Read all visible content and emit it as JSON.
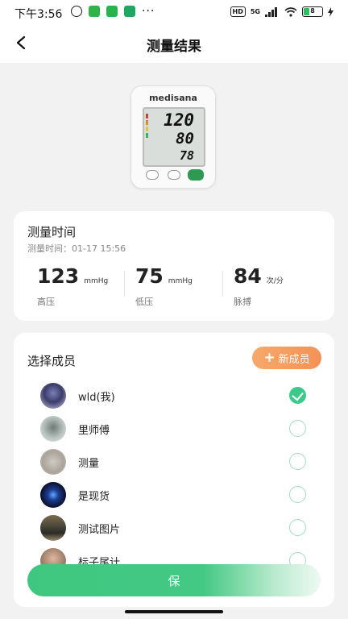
{
  "status_bar": {
    "time": "下午3:56",
    "left_icons": [
      "alarm-icon",
      "green-app-icon",
      "wechat-icon",
      "shield-app-icon",
      "more-dots-icon"
    ],
    "right": {
      "hd": "HD",
      "network": "5G",
      "battery": "8"
    }
  },
  "nav": {
    "title": "测量结果",
    "back_icon": "chevron-left-icon"
  },
  "device": {
    "brand": "medisana",
    "display": [
      "120",
      "80",
      "78"
    ]
  },
  "measurement": {
    "title": "测量时间",
    "time_label": "测量时间：01-17 15:56",
    "metrics": [
      {
        "value": "123",
        "unit": "mmHg",
        "label": "高压"
      },
      {
        "value": "75",
        "unit": "mmHg",
        "label": "低压"
      },
      {
        "value": "84",
        "unit": "次/分",
        "label": "脉搏"
      }
    ]
  },
  "members": {
    "title": "选择成员",
    "new_button": "新成员",
    "items": [
      {
        "name": "wld(我)",
        "checked": true
      },
      {
        "name": "里师傅",
        "checked": false
      },
      {
        "name": "测量",
        "checked": false
      },
      {
        "name": "是现货",
        "checked": false
      },
      {
        "name": "测试图片",
        "checked": false
      },
      {
        "name": "标子尾计",
        "checked": false
      }
    ]
  },
  "save_button": "保",
  "colors": {
    "accent": "#3dc98b",
    "orange": "#f39257",
    "background": "#f2f2f2"
  }
}
